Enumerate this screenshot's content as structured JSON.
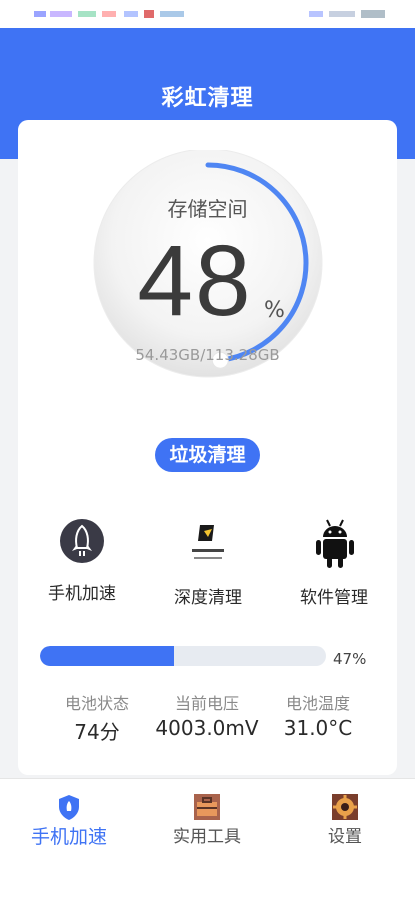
{
  "app_title": "彩虹清理",
  "storage": {
    "label": "存储空间",
    "percent": "48",
    "unit": "%",
    "fraction": 0.48,
    "used_total": "54.43GB/113.28GB"
  },
  "clean_button": "垃圾清理",
  "tools": [
    {
      "label": "手机加速",
      "icon": "rocket-icon"
    },
    {
      "label": "深度清理",
      "icon": "deep-clean-logo"
    },
    {
      "label": "软件管理",
      "icon": "android-icon"
    }
  ],
  "battery": {
    "percent_label": "47%",
    "fraction": 0.47,
    "stats": [
      {
        "label": "电池状态",
        "value": "74分"
      },
      {
        "label": "当前电压",
        "value": "4003.0mV"
      },
      {
        "label": "电池温度",
        "value": "31.0°C"
      }
    ]
  },
  "nav": [
    {
      "label": "手机加速",
      "icon": "shield-rocket-icon",
      "active": true
    },
    {
      "label": "实用工具",
      "icon": "toolbox-icon",
      "active": false
    },
    {
      "label": "设置",
      "icon": "gear-icon",
      "active": false
    }
  ],
  "colors": {
    "accent": "#3f73f4",
    "track": "#e7ebf1"
  }
}
